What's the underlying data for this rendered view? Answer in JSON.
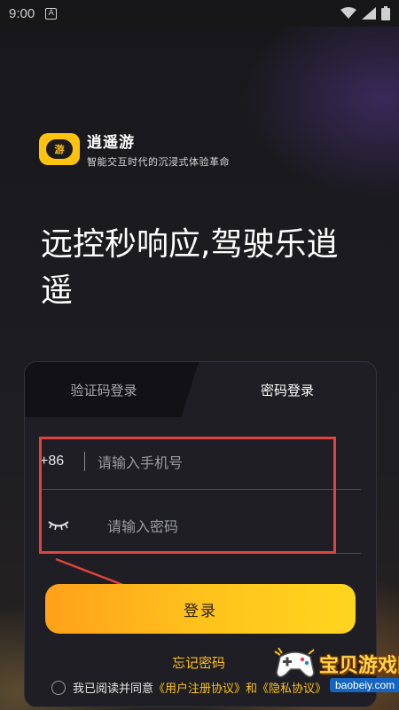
{
  "status_bar": {
    "time": "9:00",
    "notification_icon": "A"
  },
  "brand": {
    "logo_text": "游",
    "name": "逍遥游",
    "slogan": "智能交互时代的沉浸式体验革命"
  },
  "headline": "远控秒响应,驾驶乐逍遥",
  "tabs": {
    "sms_login": "验证码登录",
    "password_login": "密码登录",
    "active": "password_login"
  },
  "phone_field": {
    "country_code": "+86",
    "placeholder": "请输入手机号",
    "value": ""
  },
  "password_field": {
    "placeholder": "请输入密码",
    "value": "",
    "visibility_icon": "eye-closed-icon"
  },
  "login_button": "登录",
  "forgot_password": "忘记密码",
  "agreement": {
    "prefix": "我已阅读并同意",
    "link": "《用户注册协议》",
    "suffix": "和《隐私协议》"
  },
  "watermark": {
    "text": "宝贝游戏网",
    "url": "baobeiy.com"
  },
  "colors": {
    "accent": "#ffc20e",
    "button_start": "#ffa11a",
    "button_end": "#ffd51e",
    "highlight": "#e0433f"
  }
}
